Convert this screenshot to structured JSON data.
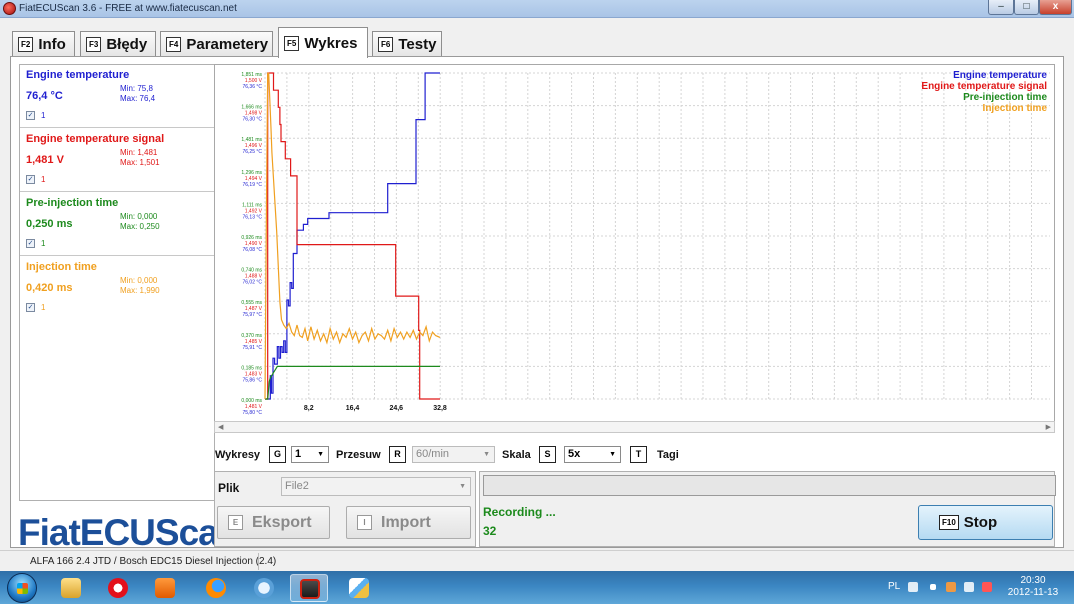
{
  "window": {
    "title": "FiatECUScan 3.6 - FREE at www.fiatecuscan.net",
    "min_icon": "minimize-icon",
    "max_icon": "maximize-icon",
    "close_icon": "close-icon",
    "close_glyph": "x"
  },
  "tabs": [
    {
      "key": "F2",
      "label": "Info"
    },
    {
      "key": "F3",
      "label": "Błędy"
    },
    {
      "key": "F4",
      "label": "Parametery"
    },
    {
      "key": "F5",
      "label": "Wykres"
    },
    {
      "key": "F6",
      "label": "Testy"
    }
  ],
  "active_tab": "Wykres",
  "sensors": [
    {
      "name": "Engine temperature",
      "value": "76,4 °C",
      "min": "Min: 75,8",
      "max": "Max: 76,4",
      "checked": "1",
      "color": "#1f1fd0"
    },
    {
      "name": "Engine temperature signal",
      "value": "1,481 V",
      "min": "Min: 1,481",
      "max": "Max: 1,501",
      "checked": "1",
      "color": "#e01818"
    },
    {
      "name": "Pre-injection time",
      "value": "0,250 ms",
      "min": "Min: 0,000",
      "max": "Max: 0,250",
      "checked": "1",
      "color": "#1d8a1d"
    },
    {
      "name": "Injection time",
      "value": "0,420 ms",
      "min": "Min: 0,000",
      "max": "Max: 1,990",
      "checked": "1",
      "color": "#f0a020"
    }
  ],
  "logo": "FiatECUScan",
  "chart_data": {
    "type": "line",
    "xlim": [
      0,
      32.8
    ],
    "x_ticks": [
      "8,2",
      "16,4",
      "24,6",
      "32,8"
    ],
    "grid": true,
    "legend_position": "top-right",
    "legend": [
      {
        "name": "Engine temperature",
        "color": "#1f1fd0"
      },
      {
        "name": "Engine temperature signal",
        "color": "#e01818"
      },
      {
        "name": "Pre-injection time",
        "color": "#1d8a1d"
      },
      {
        "name": "Injection time",
        "color": "#f0a020"
      }
    ],
    "y_tick_groups": [
      [
        "1,851 ms",
        "1,500 V",
        "76,36 °C"
      ],
      [
        "1,666 ms",
        "1,498 V",
        "76,30 °C"
      ],
      [
        "1,481 ms",
        "1,496 V",
        "76,25 °C"
      ],
      [
        "1,296 ms",
        "1,494 V",
        "76,19 °C"
      ],
      [
        "1,111 ms",
        "1,492 V",
        "76,13 °C"
      ],
      [
        "0,926 ms",
        "1,490 V",
        "76,08 °C"
      ],
      [
        "0,740 ms",
        "1,488 V",
        "76,02 °C"
      ],
      [
        "0,555 ms",
        "1,487 V",
        "75,97 °C"
      ],
      [
        "0,370 ms",
        "1,485 V",
        "75,91 °C"
      ],
      [
        "0,185 ms",
        "1,483 V",
        "75,86 °C"
      ],
      [
        "0,000 ms",
        "1,481 V",
        "75,80 °C"
      ]
    ],
    "series": [
      {
        "name": "Engine temperature",
        "color": "#1f1fd0",
        "x": [
          0,
          0.8,
          1.0,
          1.2,
          1.5,
          1.8,
          2.0,
          2.3,
          2.6,
          2.9,
          3.2,
          3.5,
          3.8,
          4.1,
          4.4,
          4.7,
          5.0,
          5.3,
          5.6,
          6.0,
          6.4,
          6.8,
          7.2,
          7.6,
          8.0,
          10,
          12,
          14,
          16,
          18,
          20,
          22,
          22.8,
          23,
          24,
          26,
          27.4,
          28,
          28.3,
          28.6,
          29,
          29.5,
          30,
          32.8
        ],
        "y": [
          75.8,
          75.8,
          75.84,
          75.81,
          75.87,
          75.86,
          75.86,
          75.89,
          75.87,
          75.89,
          75.88,
          75.9,
          75.88,
          75.97,
          75.96,
          76.0,
          75.99,
          76.05,
          76.05,
          76.09,
          76.09,
          76.09,
          76.1,
          76.1,
          76.11,
          76.11,
          76.12,
          76.12,
          76.12,
          76.12,
          76.12,
          76.12,
          76.12,
          76.17,
          76.17,
          76.17,
          76.17,
          76.17,
          76.28,
          76.28,
          76.28,
          76.28,
          76.36,
          76.36
        ]
      },
      {
        "name": "Engine temperature signal",
        "color": "#e01818",
        "x": [
          0,
          0.3,
          0.5,
          0.7,
          0.9,
          1.1,
          1.3,
          1.6,
          1.9,
          2.2,
          2.5,
          2.8,
          3.0,
          3.3,
          3.6,
          3.8,
          4.2,
          4.5,
          4.8,
          5.0,
          5.5,
          6.0,
          6.5,
          10,
          14,
          18,
          22,
          22.4,
          24.5,
          25,
          27.5,
          28.5,
          28.8,
          29,
          32.8
        ],
        "y": [
          1.481,
          1.481,
          1.5,
          1.5,
          1.5,
          1.5,
          1.5,
          1.499,
          1.499,
          1.499,
          1.498,
          1.497,
          1.496,
          1.496,
          1.496,
          1.495,
          1.495,
          1.495,
          1.494,
          1.494,
          1.494,
          1.49,
          1.49,
          1.49,
          1.49,
          1.49,
          1.49,
          1.49,
          1.487,
          1.487,
          1.487,
          1.487,
          1.485,
          1.481,
          1.481
        ]
      },
      {
        "name": "Pre-injection time",
        "color": "#1d8a1d",
        "x": [
          0,
          0.5,
          0.8,
          1.0,
          1.2,
          1.4,
          1.6,
          1.8,
          2.0,
          2.3,
          2.6,
          3.0,
          5.0,
          10,
          15,
          20,
          25,
          30,
          32.8
        ],
        "y": [
          0.0,
          0.0,
          0.1,
          0.12,
          0.13,
          0.14,
          0.15,
          0.16,
          0.17,
          0.185,
          0.185,
          0.185,
          0.185,
          0.185,
          0.185,
          0.185,
          0.185,
          0.185,
          0.185
        ]
      },
      {
        "name": "Injection time",
        "color": "#f0a020",
        "x": [
          0,
          0.3,
          0.5,
          0.7,
          0.9,
          1.1,
          1.3,
          1.6,
          1.9,
          2.2,
          2.5,
          2.8,
          3.1,
          3.5,
          4.0,
          4.5,
          5.0,
          5.5,
          6.0,
          6.5,
          7.0,
          7.5,
          8.0,
          8.6,
          9.2,
          9.8,
          10.4,
          11.0,
          11.6,
          12.2,
          12.8,
          13.4,
          14.0,
          14.6,
          15.2,
          15.8,
          16.4,
          17.0,
          17.6,
          18.2,
          18.8,
          19.4,
          20.0,
          20.6,
          21.2,
          21.8,
          22.4,
          23.0,
          23.6,
          24.2,
          24.8,
          25.4,
          26.0,
          26.6,
          27.2,
          27.8,
          28.4,
          29.0,
          29.6,
          30.2,
          30.8,
          31.4,
          32.0,
          32.8
        ],
        "y": [
          0.0,
          1.2,
          1.85,
          1.85,
          1.7,
          1.55,
          1.4,
          1.25,
          1.1,
          0.95,
          0.75,
          0.55,
          0.45,
          0.42,
          0.4,
          0.43,
          0.38,
          0.36,
          0.42,
          0.36,
          0.35,
          0.4,
          0.33,
          0.41,
          0.34,
          0.39,
          0.33,
          0.37,
          0.32,
          0.4,
          0.34,
          0.38,
          0.32,
          0.37,
          0.35,
          0.4,
          0.34,
          0.38,
          0.32,
          0.36,
          0.38,
          0.33,
          0.4,
          0.34,
          0.37,
          0.36,
          0.34,
          0.39,
          0.33,
          0.4,
          0.35,
          0.38,
          0.34,
          0.38,
          0.35,
          0.39,
          0.34,
          0.38,
          0.36,
          0.41,
          0.33,
          0.38,
          0.36,
          0.35
        ]
      }
    ]
  },
  "controls": {
    "wykresy_label": "Wykresy",
    "wykresy_key": "G",
    "wykresy_value": "1",
    "przesuw_label": "Przesuw",
    "przesuw_key": "R",
    "przesuw_value": "60/min",
    "skala_label": "Skala",
    "skala_key": "S",
    "skala_value": "5x",
    "tagi_key": "T",
    "tagi_label": "Tagi"
  },
  "plik": {
    "label": "Plik",
    "value": "File2",
    "export_key": "E",
    "export_label": "Eksport",
    "import_key": "I",
    "import_label": "Import"
  },
  "recording": {
    "status": "Recording ...",
    "count": "32",
    "stop_key": "F10",
    "stop_label": "Stop"
  },
  "statusbar": {
    "text": "ALFA 166 2.4 JTD / Bosch EDC15 Diesel Injection (2.4)"
  },
  "taskbar": {
    "icons": [
      "windows-start-icon",
      "explorer-icon",
      "opera-icon",
      "media-player-icon",
      "firefox-icon",
      "app-icon",
      "fiatecuscan-icon",
      "paint-icon"
    ],
    "lang": "PL",
    "time": "20:30",
    "date": "2012-11-13"
  }
}
